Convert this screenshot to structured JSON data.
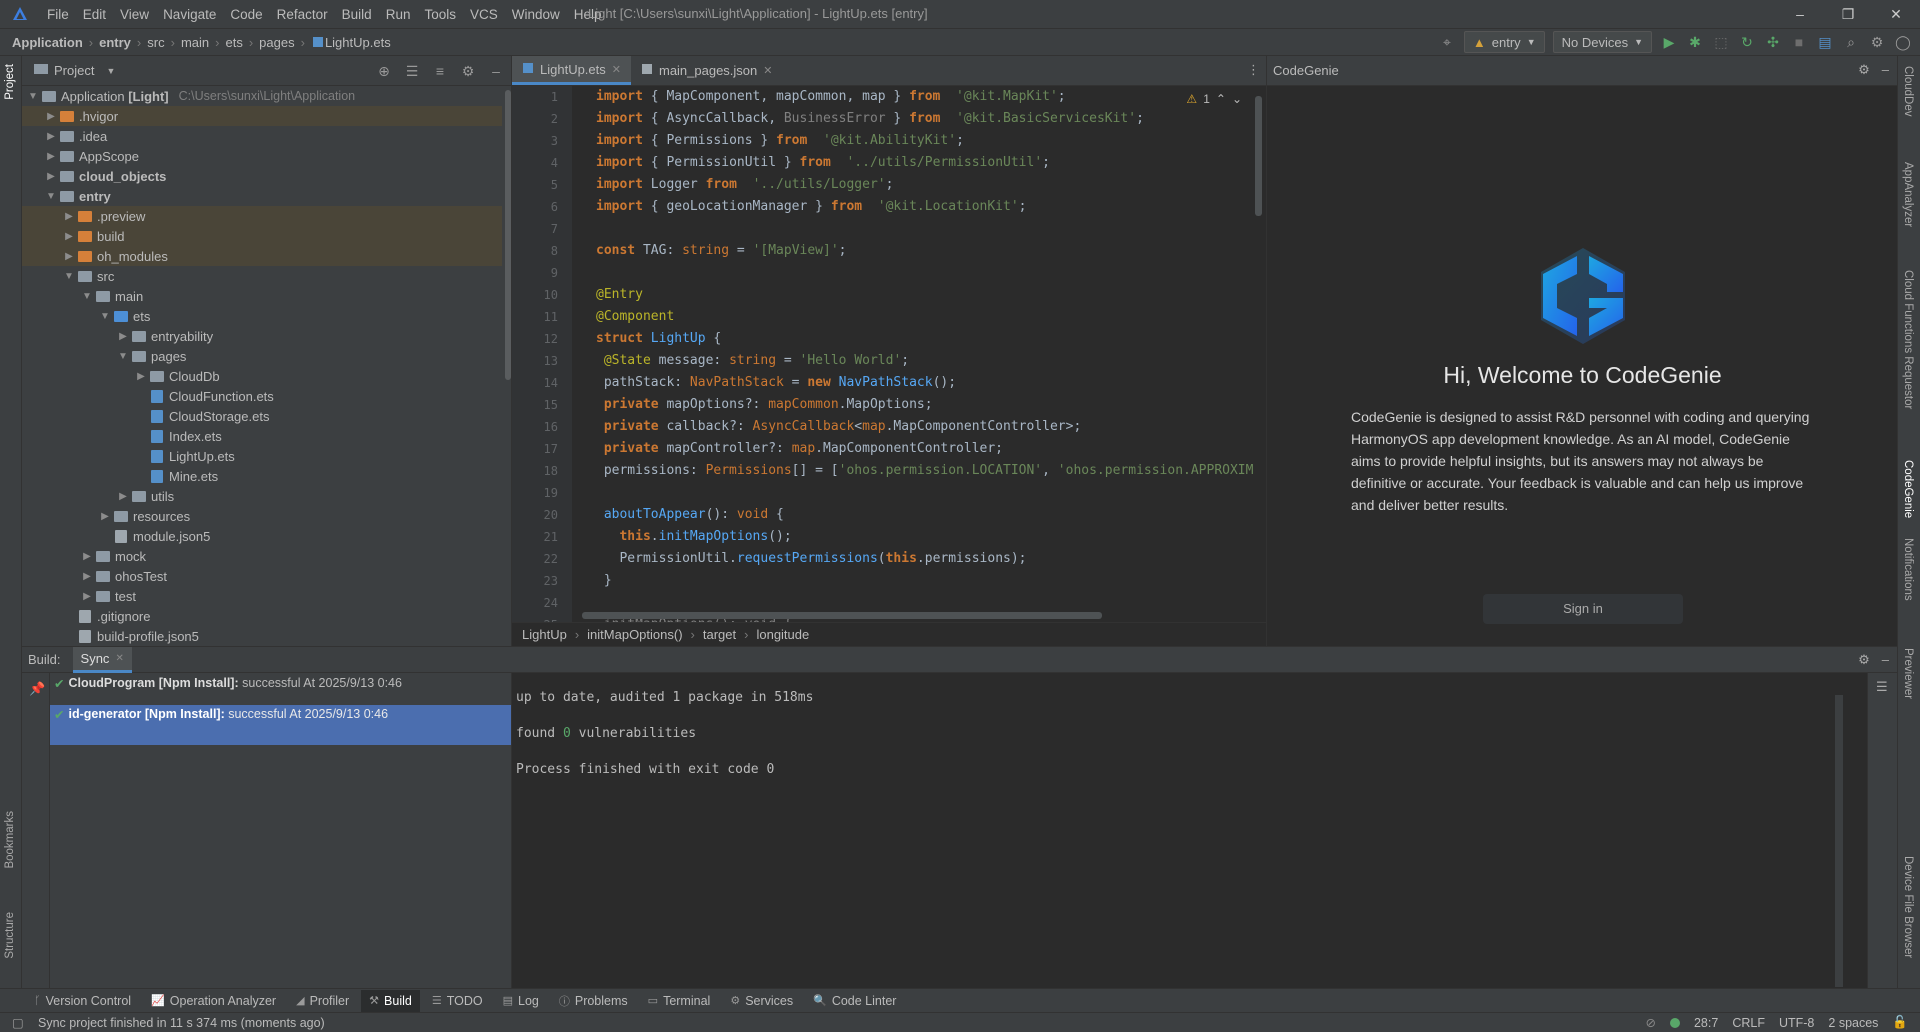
{
  "window": {
    "title": "Light [C:\\Users\\sunxi\\Light\\Application] - LightUp.ets [entry]",
    "minimize": "–",
    "maximize": "❐",
    "close": "✕"
  },
  "menu": [
    "File",
    "Edit",
    "View",
    "Navigate",
    "Code",
    "Refactor",
    "Build",
    "Run",
    "Tools",
    "VCS",
    "Window",
    "Help"
  ],
  "breadcrumbs": [
    "Application",
    "entry",
    "src",
    "main",
    "ets",
    "pages",
    "LightUp.ets"
  ],
  "run_config": {
    "module": "entry",
    "device": "No Devices"
  },
  "project_panel": {
    "title": "Project",
    "tree": [
      {
        "label": "Application [Light]",
        "hint": "C:\\Users\\sunxi\\Light\\Application",
        "depth": 0,
        "arrow": "open",
        "icon": "folder-gray",
        "bold": false
      },
      {
        "label": ".hvigor",
        "depth": 1,
        "arrow": "closed",
        "icon": "folder-orange",
        "excluded": true
      },
      {
        "label": ".idea",
        "depth": 1,
        "arrow": "closed",
        "icon": "folder-gray"
      },
      {
        "label": "AppScope",
        "depth": 1,
        "arrow": "closed",
        "icon": "folder-gray"
      },
      {
        "label": "cloud_objects",
        "depth": 1,
        "arrow": "closed",
        "icon": "folder-gray",
        "bold": true
      },
      {
        "label": "entry",
        "depth": 1,
        "arrow": "open",
        "icon": "folder-gray",
        "bold": true
      },
      {
        "label": ".preview",
        "depth": 2,
        "arrow": "closed",
        "icon": "folder-orange",
        "excluded": true
      },
      {
        "label": "build",
        "depth": 2,
        "arrow": "closed",
        "icon": "folder-orange",
        "excluded": true
      },
      {
        "label": "oh_modules",
        "depth": 2,
        "arrow": "closed",
        "icon": "folder-orange",
        "excluded": true
      },
      {
        "label": "src",
        "depth": 2,
        "arrow": "open",
        "icon": "folder-gray"
      },
      {
        "label": "main",
        "depth": 3,
        "arrow": "open",
        "icon": "folder-gray"
      },
      {
        "label": "ets",
        "depth": 4,
        "arrow": "open",
        "icon": "folder-blue"
      },
      {
        "label": "entryability",
        "depth": 5,
        "arrow": "closed",
        "icon": "folder-gray"
      },
      {
        "label": "pages",
        "depth": 5,
        "arrow": "open",
        "icon": "folder-gray"
      },
      {
        "label": "CloudDb",
        "depth": 6,
        "arrow": "closed",
        "icon": "folder-gray"
      },
      {
        "label": "CloudFunction.ets",
        "depth": 6,
        "arrow": "none",
        "icon": "file"
      },
      {
        "label": "CloudStorage.ets",
        "depth": 6,
        "arrow": "none",
        "icon": "file"
      },
      {
        "label": "Index.ets",
        "depth": 6,
        "arrow": "none",
        "icon": "file"
      },
      {
        "label": "LightUp.ets",
        "depth": 6,
        "arrow": "none",
        "icon": "file"
      },
      {
        "label": "Mine.ets",
        "depth": 6,
        "arrow": "none",
        "icon": "file"
      },
      {
        "label": "utils",
        "depth": 5,
        "arrow": "closed",
        "icon": "folder-gray"
      },
      {
        "label": "resources",
        "depth": 4,
        "arrow": "closed",
        "icon": "folder-gray"
      },
      {
        "label": "module.json5",
        "depth": 4,
        "arrow": "none",
        "icon": "file-plain"
      },
      {
        "label": "mock",
        "depth": 3,
        "arrow": "closed",
        "icon": "folder-gray"
      },
      {
        "label": "ohosTest",
        "depth": 3,
        "arrow": "closed",
        "icon": "folder-gray"
      },
      {
        "label": "test",
        "depth": 3,
        "arrow": "closed",
        "icon": "folder-gray"
      },
      {
        "label": ".gitignore",
        "depth": 2,
        "arrow": "none",
        "icon": "file-plain"
      },
      {
        "label": "build-profile.json5",
        "depth": 2,
        "arrow": "none",
        "icon": "file-plain"
      }
    ]
  },
  "editor": {
    "tabs": [
      {
        "label": "LightUp.ets",
        "active": true
      },
      {
        "label": "main_pages.json",
        "active": false
      }
    ],
    "warning_count": "1",
    "lines": [
      [
        [
          "kwb",
          "import"
        ],
        [
          "",
          "{ MapComponent, mapCommon, map } "
        ],
        [
          "kwb",
          "from"
        ],
        [
          "",
          "  "
        ],
        [
          "st",
          "'@kit.MapKit'"
        ],
        [
          "",
          ";"
        ]
      ],
      [
        [
          "kwb",
          "import"
        ],
        [
          "",
          "{ AsyncCallback, "
        ],
        [
          "gr",
          "BusinessError"
        ],
        [
          "",
          " } "
        ],
        [
          "kwb",
          "from"
        ],
        [
          "",
          "  "
        ],
        [
          "st",
          "'@kit.BasicServicesKit'"
        ],
        [
          "",
          ";"
        ]
      ],
      [
        [
          "kwb",
          "import"
        ],
        [
          "",
          "{ Permissions } "
        ],
        [
          "kwb",
          "from"
        ],
        [
          "",
          "  "
        ],
        [
          "st",
          "'@kit.AbilityKit'"
        ],
        [
          "",
          ";"
        ]
      ],
      [
        [
          "kwb",
          "import"
        ],
        [
          "",
          "{ PermissionUtil } "
        ],
        [
          "kwb",
          "from"
        ],
        [
          "",
          "  "
        ],
        [
          "st",
          "'../utils/PermissionUtil'"
        ],
        [
          "",
          ";"
        ]
      ],
      [
        [
          "kwb",
          "import"
        ],
        [
          "",
          "Logger "
        ],
        [
          "kwb",
          "from"
        ],
        [
          "",
          "  "
        ],
        [
          "st",
          "'../utils/Logger'"
        ],
        [
          "",
          ";"
        ]
      ],
      [
        [
          "kwb",
          "import"
        ],
        [
          "",
          "{ geoLocationManager } "
        ],
        [
          "kwb",
          "from"
        ],
        [
          "",
          "  "
        ],
        [
          "st",
          "'@kit.LocationKit'"
        ],
        [
          "",
          ";"
        ]
      ],
      [
        [
          "",
          ""
        ]
      ],
      [
        [
          "kwb",
          "const"
        ],
        [
          "",
          " TAG: "
        ],
        [
          "ty",
          "string"
        ],
        [
          "",
          " = "
        ],
        [
          "st",
          "'[MapView]'"
        ],
        [
          "",
          ";"
        ]
      ],
      [
        [
          "",
          ""
        ]
      ],
      [
        [
          "an",
          "@Entry"
        ]
      ],
      [
        [
          "an",
          "@Component"
        ]
      ],
      [
        [
          "kwb",
          "struct"
        ],
        [
          "",
          " "
        ],
        [
          "mt",
          "LightUp"
        ],
        [
          "",
          " {"
        ]
      ],
      [
        [
          "",
          " "
        ],
        [
          "an",
          "@State"
        ],
        [
          "",
          " message: "
        ],
        [
          "ty",
          "string"
        ],
        [
          "",
          " = "
        ],
        [
          "st",
          "'Hello World'"
        ],
        [
          "",
          ";"
        ]
      ],
      [
        [
          "",
          " pathStack: "
        ],
        [
          "ty",
          "NavPathStack"
        ],
        [
          "",
          " = "
        ],
        [
          "kwb",
          "new"
        ],
        [
          "",
          " "
        ],
        [
          "mt",
          "NavPathStack"
        ],
        [
          "",
          "();"
        ]
      ],
      [
        [
          "",
          " "
        ],
        [
          "kwb",
          "private"
        ],
        [
          "",
          " mapOptions?: "
        ],
        [
          "ty",
          "mapCommon"
        ],
        [
          "",
          ".MapOptions;"
        ]
      ],
      [
        [
          "",
          " "
        ],
        [
          "kwb",
          "private"
        ],
        [
          "",
          " callback?: "
        ],
        [
          "ty",
          "AsyncCallback"
        ],
        [
          "",
          "<"
        ],
        [
          "ty",
          "map"
        ],
        [
          "",
          ".MapComponentController>;"
        ]
      ],
      [
        [
          "",
          " "
        ],
        [
          "kwb",
          "private"
        ],
        [
          "",
          " mapController?: "
        ],
        [
          "ty",
          "map"
        ],
        [
          "",
          ".MapComponentController;"
        ]
      ],
      [
        [
          "",
          " permissions: "
        ],
        [
          "ty",
          "Permissions"
        ],
        [
          "",
          "[] = ["
        ],
        [
          "st",
          "'ohos.permission.LOCATION'"
        ],
        [
          "",
          ", "
        ],
        [
          "st",
          "'ohos.permission.APPROXIM"
        ]
      ],
      [
        [
          "",
          ""
        ]
      ],
      [
        [
          "",
          " "
        ],
        [
          "mt",
          "aboutToAppear"
        ],
        [
          "",
          "(): "
        ],
        [
          "ty",
          "void"
        ],
        [
          "",
          " {"
        ]
      ],
      [
        [
          "",
          "   "
        ],
        [
          "kwb",
          "this"
        ],
        [
          "",
          "."
        ],
        [
          "mt",
          "initMapOptions"
        ],
        [
          "",
          "();"
        ]
      ],
      [
        [
          "",
          "   PermissionUtil."
        ],
        [
          "mt",
          "requestPermissions"
        ],
        [
          "",
          "("
        ],
        [
          "kwb",
          "this"
        ],
        [
          "",
          ".permissions);"
        ]
      ],
      [
        [
          "",
          " }"
        ]
      ],
      [
        [
          "",
          ""
        ]
      ],
      [
        [
          "",
          " "
        ],
        [
          "gr",
          "initMapOptions(): void {"
        ]
      ]
    ],
    "breadcrumb": [
      "LightUp",
      "initMapOptions()",
      "target",
      "longitude"
    ]
  },
  "codegenie": {
    "panel_title": "CodeGenie",
    "welcome": "Hi, Welcome to CodeGenie",
    "description": "CodeGenie is designed to assist R&D personnel with coding and querying HarmonyOS app development knowledge. As an AI model, CodeGenie aims to provide helpful insights, but its answers may not always be definitive or accurate. Your feedback is valuable and can help us improve and deliver better results.",
    "sign_in": "Sign in",
    "brand_colors": [
      "#1ea7e1",
      "#2463eb"
    ]
  },
  "build_panel": {
    "label": "Build:",
    "tab": "Sync",
    "items": [
      {
        "name": "CloudProgram [Npm Install]:",
        "rest": " successful At 2025/9/13 0:46",
        "selected": false
      },
      {
        "name": "id-generator [Npm Install]:",
        "rest": " successful At 2025/9/13 0:46",
        "selected": true
      }
    ],
    "output": {
      "line1": "up to date, audited 1 package in 518ms",
      "line2_prefix": "found ",
      "line2_zero": "0",
      "line2_suffix": " vulnerabilities",
      "line3": "Process finished with exit code 0"
    }
  },
  "left_stripe": {
    "top": "Project",
    "bottom1": "Bookmarks",
    "bottom2": "Structure"
  },
  "right_stripe": [
    "CloudDev",
    "AppAnalyzer",
    "Cloud Functions Requestor",
    "CodeGenie",
    "Notifications",
    "Previewer",
    "Device File Browser"
  ],
  "toolwindows": [
    {
      "label": "Version Control",
      "icon": "branch-icon",
      "active": false
    },
    {
      "label": "Operation Analyzer",
      "icon": "chart-icon",
      "active": false
    },
    {
      "label": "Profiler",
      "icon": "profiler-icon",
      "active": false
    },
    {
      "label": "Build",
      "icon": "hammer-icon",
      "active": true
    },
    {
      "label": "TODO",
      "icon": "list-icon",
      "active": false
    },
    {
      "label": "Log",
      "icon": "log-icon",
      "active": false
    },
    {
      "label": "Problems",
      "icon": "info-icon",
      "active": false
    },
    {
      "label": "Terminal",
      "icon": "terminal-icon",
      "active": false
    },
    {
      "label": "Services",
      "icon": "services-icon",
      "active": false
    },
    {
      "label": "Code Linter",
      "icon": "linter-icon",
      "active": false
    }
  ],
  "status": {
    "message": "Sync project finished in 11 s 374 ms (moments ago)",
    "position": "28:7",
    "line_ending": "CRLF",
    "encoding": "UTF-8",
    "indent": "2 spaces"
  }
}
